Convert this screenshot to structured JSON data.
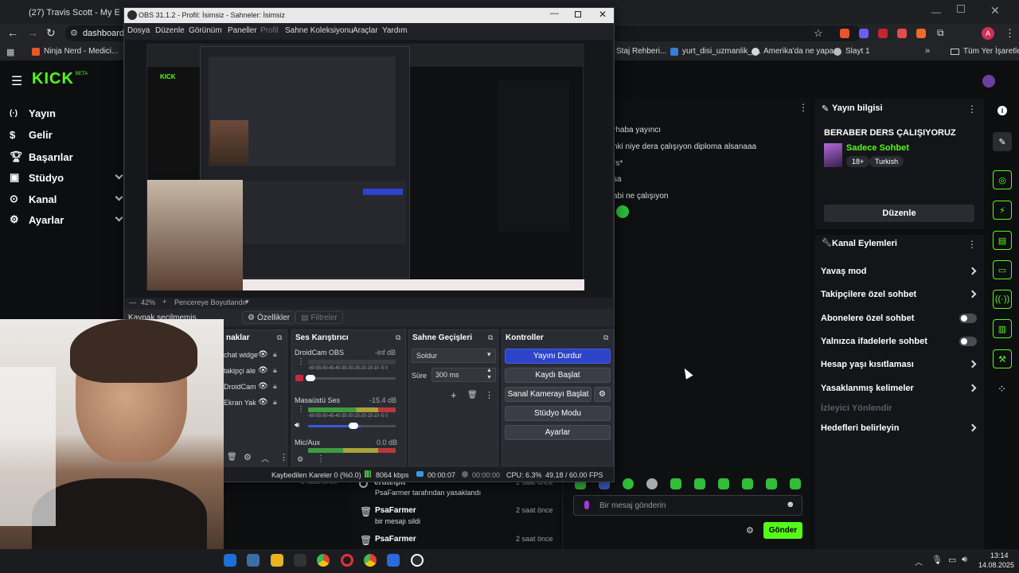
{
  "browser": {
    "tabs": [
      "(27) Travis Scott - My Eyes (Lo"
    ],
    "url": "dashboard.k",
    "profile_initial": "A",
    "bookmarks": [
      "Ninja Nerd - Medici...",
      "Staj Rehberi...",
      "yurt_disi_uzmanlik_r...",
      "Amerika'da ne yapa...",
      "Slayt 1",
      "Tüm Yer İşaretleri"
    ]
  },
  "kick": {
    "logo": "KICK",
    "logo_badge": "BETA",
    "nav": [
      {
        "label": "Yayın",
        "icon": "broadcast-icon"
      },
      {
        "label": "Gelir",
        "icon": "revenue-icon"
      },
      {
        "label": "Başarılar",
        "icon": "trophy-icon"
      },
      {
        "label": "Stüdyo",
        "icon": "studio-icon"
      },
      {
        "label": "Kanal",
        "icon": "channel-icon"
      },
      {
        "label": "Ayarlar",
        "icon": "gear-icon"
      }
    ]
  },
  "chat": {
    "lines": [
      "rhaba yayıncı",
      "nki niye dera çalışıyon diploma alsanaaa",
      "rs*",
      "sa",
      "abi ne çalışıyon"
    ],
    "events": [
      {
        "user": "erdtelpit",
        "text": "PsaFarmer tarafından yasaklandı",
        "time": "2 saat önce"
      },
      {
        "user": "PsaFarmer",
        "text": "bir mesajı sildi",
        "time": "2 saat önce"
      },
      {
        "user": "PsaFarmer",
        "text": "",
        "time": "2 saat önce"
      }
    ],
    "prev_time": "2 saat önce",
    "input_placeholder": "Bir mesaj gönderin",
    "send_label": "Gönder"
  },
  "stream_info": {
    "header": "Yayın bilgisi",
    "title": "BERABER DERS ÇALIŞIYORUZ",
    "category": "Sadece Sohbet",
    "tags": [
      "18+",
      "Turkish"
    ],
    "edit_label": "Düzenle"
  },
  "channel_actions": {
    "header": "Kanal Eylemleri",
    "items": [
      {
        "label": "Yavaş mod",
        "control": "chevron"
      },
      {
        "label": "Takipçilere özel sohbet",
        "control": "chevron"
      },
      {
        "label": "Abonelere özel sohbet",
        "control": "toggle"
      },
      {
        "label": "Yalnızca ifadelerle sohbet",
        "control": "toggle"
      },
      {
        "label": "Hesap yaşı kısıtlaması",
        "control": "chevron"
      },
      {
        "label": "Yasaklanmış kelimeler",
        "control": "chevron"
      },
      {
        "label": "İzleyici Yönlendir",
        "control": "disabled"
      },
      {
        "label": "Hedefleri belirleyin",
        "control": "chevron"
      }
    ]
  },
  "obs": {
    "title": "OBS 31.1.2 - Profil: İsimsiz - Sahneler: İsimsiz",
    "menu": [
      "Dosya",
      "Düzenle",
      "Görünüm",
      "Paneller",
      "Profil",
      "Sahne Koleksiyonu",
      "Araçlar",
      "Yardım"
    ],
    "zoom": "42%",
    "resize_label": "Pencereye Boyutlandır",
    "no_source": "Kaynak seçilmemiş",
    "properties_label": "Özellikler",
    "filters_label": "Filtreler",
    "sources_title": "naklar",
    "sources": [
      "chat widge",
      "takipçi ale",
      "DroidCam",
      "Ekran Yak"
    ],
    "mixer_title": "Ses Karıştırıcı",
    "mixer": [
      {
        "name": "DroidCam OBS",
        "level": "-inf dB"
      },
      {
        "name": "Masaüstü Ses",
        "level": "-15.4 dB"
      },
      {
        "name": "Mic/Aux",
        "level": "0.0 dB"
      }
    ],
    "meter_scale": "-60-55-50-45-40-35-30-25-20-15-10 -5 0",
    "transitions_title": "Sahne Geçişleri",
    "transition": "Soldur",
    "duration_label": "Süre",
    "duration": "300 ms",
    "controls_title": "Kontroller",
    "controls": [
      "Yayını Durdur",
      "Kaydı Başlat",
      "Sanal Kamerayı Başlat",
      "Stüdyo Modu",
      "Ayarlar"
    ],
    "status": {
      "dropped": "Kaybedilen Kareler 0 (%0.0)",
      "bitrate": "8064 kbps",
      "live": "00:00:07",
      "rec": "00:00:00",
      "cpu": "CPU: 6.3%",
      "fps": "49.18 / 60.00 FPS"
    }
  },
  "taskbar": {
    "time": "13:14",
    "date": "14.08.2025"
  },
  "colors": {
    "kick_green": "#53fc18",
    "obs_accent": "#2d43c9"
  }
}
